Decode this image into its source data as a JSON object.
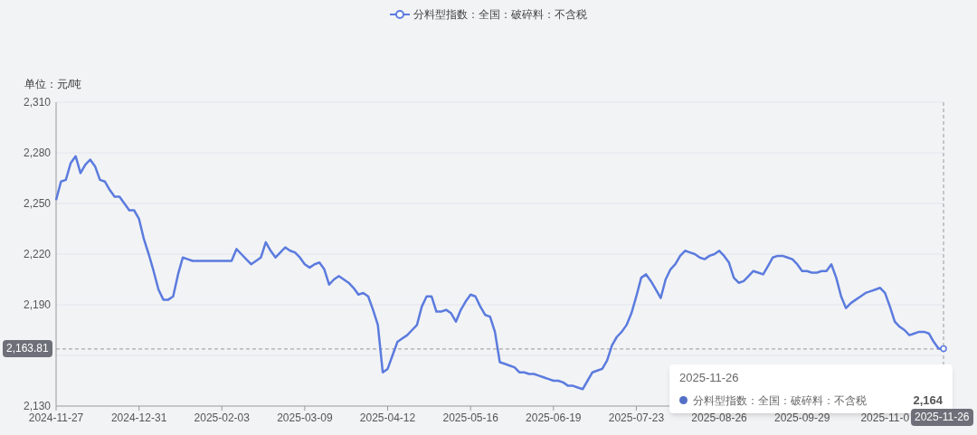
{
  "unit_label": "单位：元/吨",
  "chart_data": {
    "type": "line",
    "grid": true,
    "ref_lines": [
      {
        "axis": "y",
        "value": 2163.81
      }
    ],
    "ylim": [
      2130,
      2310
    ],
    "yticks": [
      {
        "value": 2130,
        "label": "2,130"
      },
      {
        "value": 2190,
        "label": "2,190"
      },
      {
        "value": 2220,
        "label": "2,220"
      },
      {
        "value": 2250,
        "label": "2,250"
      },
      {
        "value": 2280,
        "label": "2,280"
      },
      {
        "value": 2310,
        "label": "2,310"
      }
    ],
    "categories": [
      "2024-11-27",
      null,
      null,
      null,
      null,
      null,
      null,
      null,
      null,
      null,
      null,
      null,
      null,
      null,
      null,
      null,
      null,
      "2024-12-31",
      null,
      null,
      null,
      null,
      null,
      null,
      null,
      null,
      null,
      null,
      null,
      null,
      null,
      null,
      null,
      null,
      "2025-02-03",
      null,
      null,
      null,
      null,
      null,
      null,
      null,
      null,
      null,
      null,
      null,
      null,
      null,
      null,
      null,
      null,
      "2025-03-09",
      null,
      null,
      null,
      null,
      null,
      null,
      null,
      null,
      null,
      null,
      null,
      null,
      null,
      null,
      null,
      null,
      "2025-04-12",
      null,
      null,
      null,
      null,
      null,
      null,
      null,
      null,
      null,
      null,
      null,
      null,
      null,
      null,
      null,
      null,
      "2025-05-16",
      null,
      null,
      null,
      null,
      null,
      null,
      null,
      null,
      null,
      null,
      null,
      null,
      null,
      null,
      null,
      null,
      "2025-06-19",
      null,
      null,
      null,
      null,
      null,
      null,
      null,
      null,
      null,
      null,
      null,
      null,
      null,
      null,
      null,
      null,
      "2025-07-23",
      null,
      null,
      null,
      null,
      null,
      null,
      null,
      null,
      null,
      null,
      null,
      null,
      null,
      null,
      null,
      null,
      "2025-08-26",
      null,
      null,
      null,
      null,
      null,
      null,
      null,
      null,
      null,
      null,
      null,
      null,
      null,
      null,
      null,
      null,
      "2025-09-29",
      null,
      null,
      null,
      null,
      null,
      null,
      null,
      null,
      null,
      null,
      null,
      null,
      null,
      null,
      null,
      null,
      "2025-11-0",
      null,
      null,
      null,
      null,
      null,
      null,
      null,
      null,
      null,
      null,
      null,
      null
    ],
    "series": [
      {
        "name": "分料型指数：全国：破碎料：不含税",
        "color": "#5b7bde",
        "values": [
          2252,
          2263,
          2264,
          2274,
          2278,
          2268,
          2273,
          2276,
          2272,
          2264,
          2263,
          2258,
          2254,
          2254,
          2250,
          2246,
          2246,
          2241,
          2229,
          2220,
          2210,
          2199,
          2193,
          2193,
          2195,
          2208,
          2218,
          2217,
          2216,
          2216,
          2216,
          2216,
          2216,
          2216,
          2216,
          2216,
          2216,
          2223,
          2220,
          2217,
          2214,
          2216,
          2218,
          2227,
          2222,
          2218,
          2221,
          2224,
          2222,
          2221,
          2218,
          2214,
          2212,
          2214,
          2215,
          2211,
          2202,
          2205,
          2207,
          2205,
          2203,
          2200,
          2196,
          2197,
          2195,
          2187,
          2178,
          2150,
          2152,
          2160,
          2168,
          2170,
          2172,
          2175,
          2178,
          2189,
          2195,
          2195,
          2186,
          2186,
          2187,
          2185,
          2180,
          2187,
          2192,
          2196,
          2195,
          2189,
          2184,
          2183,
          2174,
          2156,
          2155,
          2154,
          2153,
          2150,
          2150,
          2149,
          2149,
          2148,
          2147,
          2146,
          2145,
          2145,
          2144,
          2142,
          2142,
          2141,
          2140,
          2145,
          2150,
          2151,
          2152,
          2157,
          2166,
          2171,
          2174,
          2178,
          2185,
          2195,
          2206,
          2208,
          2204,
          2199,
          2194,
          2205,
          2211,
          2214,
          2219,
          2222,
          2221,
          2220,
          2218,
          2217,
          2219,
          2220,
          2222,
          2219,
          2215,
          2206,
          2203,
          2204,
          2207,
          2210,
          2209,
          2208,
          2213,
          2218,
          2219,
          2219,
          2218,
          2217,
          2214,
          2210,
          2210,
          2209,
          2209,
          2210,
          2210,
          2214,
          2206,
          2195,
          2188,
          2191,
          2193,
          2195,
          2197,
          2198,
          2199,
          2200,
          2197,
          2189,
          2180,
          2177,
          2175,
          2172,
          2173,
          2174,
          2174,
          2173,
          2168,
          2164,
          2164
        ]
      }
    ]
  },
  "axis_pointer": {
    "y_label": "2,163.81",
    "x_label": "2025-11-26"
  },
  "tooltip": {
    "date": "2025-11-26",
    "series": "分料型指数：全国：破碎料：不含税",
    "value": "2,164",
    "color": "#5470c6"
  }
}
